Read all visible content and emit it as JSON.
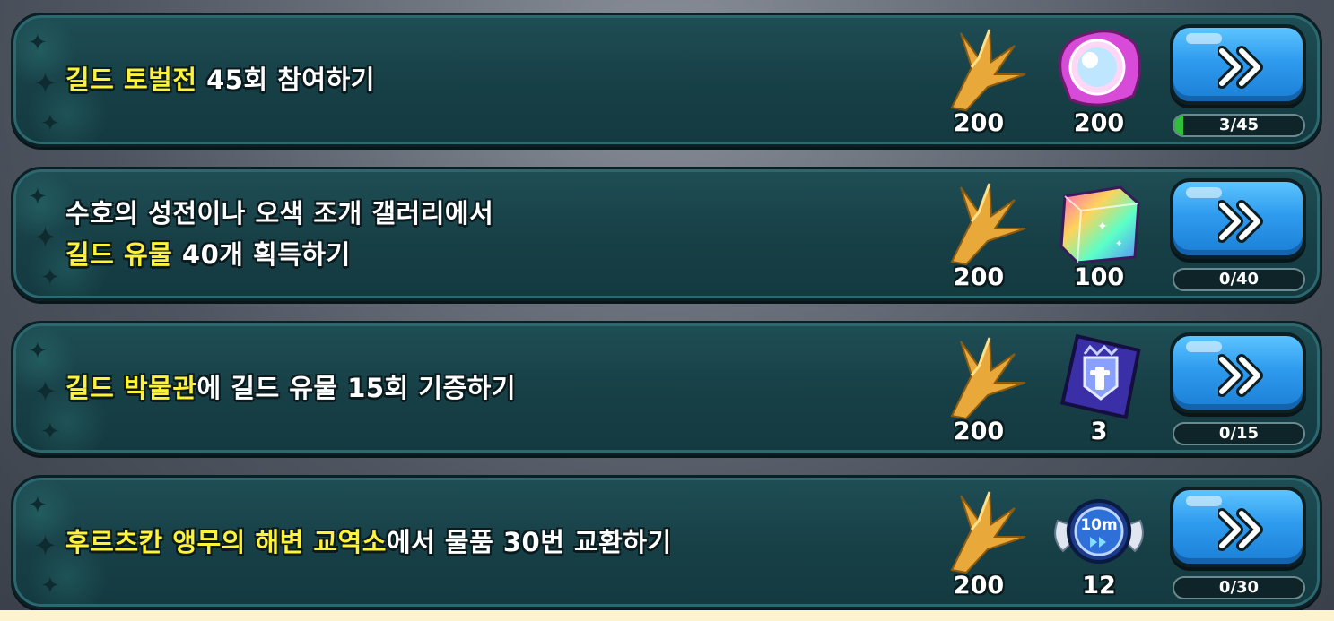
{
  "colors": {
    "highlight_text": "#fff23a",
    "normal_text": "#ffffff",
    "row_bg": "#1a454b",
    "button_blue": "#2f9bee",
    "progress_fill": "#2fbf3a"
  },
  "quests": [
    {
      "lines": [
        [
          {
            "text": "길드 토벌전",
            "highlight": true
          },
          {
            "text": " 45회 참여하기",
            "highlight": false
          }
        ]
      ],
      "rewards": [
        {
          "icon": "gold-branch-icon",
          "amount": "200"
        },
        {
          "icon": "rainbow-pearl-icon",
          "amount": "200"
        }
      ],
      "go_label": "»",
      "progress": {
        "text": "3/45",
        "fraction": 0.0667
      }
    },
    {
      "lines": [
        [
          {
            "text": "수호의 성전이나 오색 조개 갤러리에서",
            "highlight": false
          }
        ],
        [
          {
            "text": "길드 유물",
            "highlight": true
          },
          {
            "text": " 40개 획득하기",
            "highlight": false
          }
        ]
      ],
      "rewards": [
        {
          "icon": "gold-branch-icon",
          "amount": "200"
        },
        {
          "icon": "rainbow-cube-icon",
          "amount": "100"
        }
      ],
      "go_label": "»",
      "progress": {
        "text": "0/40",
        "fraction": 0
      }
    },
    {
      "lines": [
        [
          {
            "text": "길드 박물관",
            "highlight": true
          },
          {
            "text": "에 길드 유물 15회 기증하기",
            "highlight": false
          }
        ]
      ],
      "rewards": [
        {
          "icon": "gold-branch-icon",
          "amount": "200"
        },
        {
          "icon": "guild-relic-box-icon",
          "amount": "3"
        }
      ],
      "go_label": "»",
      "progress": {
        "text": "0/15",
        "fraction": 0
      }
    },
    {
      "lines": [
        [
          {
            "text": "후르츠칸 앵무의 해변 교역소",
            "highlight": true
          },
          {
            "text": "에서 물품 30번 교환하기",
            "highlight": false
          }
        ]
      ],
      "rewards": [
        {
          "icon": "gold-branch-icon",
          "amount": "200"
        },
        {
          "icon": "time-jumper-10m-icon",
          "amount": "12",
          "badge": "10m"
        }
      ],
      "go_label": "»",
      "progress": {
        "text": "0/30",
        "fraction": 0
      }
    }
  ]
}
